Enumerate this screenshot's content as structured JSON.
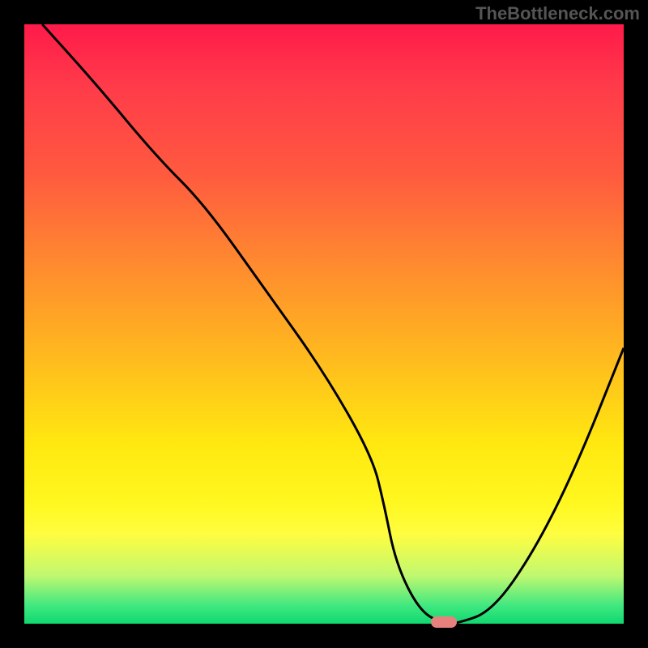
{
  "watermark": "TheBottleneck.com",
  "chart_data": {
    "type": "line",
    "title": "",
    "xlabel": "",
    "ylabel": "",
    "xlim": [
      0,
      100
    ],
    "ylim": [
      0,
      100
    ],
    "series": [
      {
        "name": "curve",
        "x": [
          3,
          12,
          22,
          30,
          40,
          50,
          58,
          60,
          62,
          66,
          70,
          72,
          78,
          85,
          92,
          100
        ],
        "y": [
          100,
          90,
          78,
          70,
          56,
          42,
          28,
          20,
          10,
          2,
          0,
          0,
          2,
          12,
          26,
          46
        ]
      }
    ],
    "marker": {
      "x": 70,
      "y": 0
    },
    "gradient_stops": [
      {
        "pos": 0,
        "color": "#ff1a4a"
      },
      {
        "pos": 25,
        "color": "#ff5a3f"
      },
      {
        "pos": 55,
        "color": "#ffb81f"
      },
      {
        "pos": 80,
        "color": "#fff820"
      },
      {
        "pos": 100,
        "color": "#10d870"
      }
    ]
  }
}
